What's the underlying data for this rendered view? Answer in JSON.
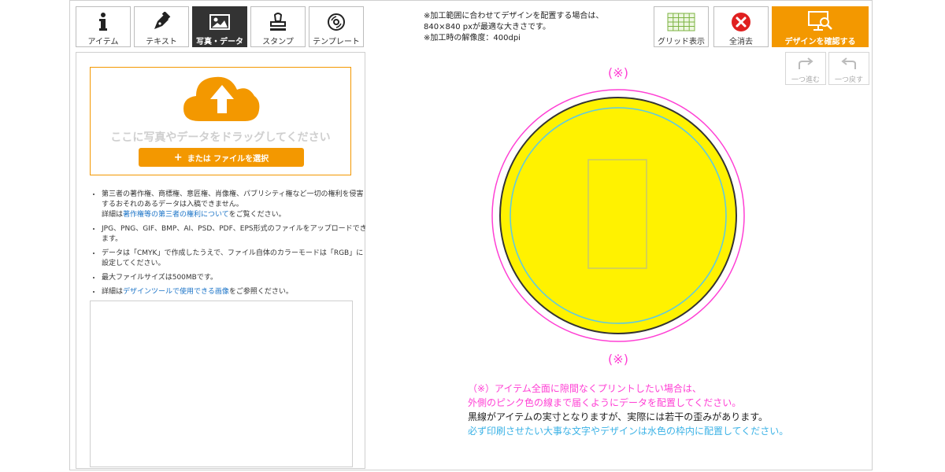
{
  "tabs": [
    {
      "label": "アイテム",
      "icon": "info-icon"
    },
    {
      "label": "テキスト",
      "icon": "pen-icon"
    },
    {
      "label": "写真・データ",
      "icon": "image-icon",
      "active": true
    },
    {
      "label": "スタンプ",
      "icon": "stamp-icon"
    },
    {
      "label": "テンプレート",
      "icon": "disc-icon"
    }
  ],
  "upload": {
    "drop_text": "ここに写真やデータをドラッグしてください",
    "file_button": "または ファイルを選択",
    "file_button_plus": "+",
    "accent": "#f39800"
  },
  "notes": {
    "n1_a": "第三者の著作権、商標権、意匠権、肖像権、パブリシティ権など一切の権利を侵害するおそれのあるデータは入稿できません。",
    "n1_b": "詳細は",
    "n1_link": "著作権等の第三者の権利について",
    "n1_c": "をご覧ください。",
    "n2": "JPG、PNG、GIF、BMP、AI、PSD、PDF、EPS形式のファイルをアップロードできます。",
    "n3": "データは「CMYK」で作成したうえで、ファイル自体のカラーモードは「RGB」に設定してください。",
    "n4": "最大ファイルサイズは500MBです。",
    "n5_a": "詳細は",
    "n5_link": "デザインツールで使用できる画像",
    "n5_b": "をご参照ください。"
  },
  "header_note": {
    "line1": "※加工範囲に合わせてデザインを配置する場合は、",
    "line2": "840×840 pxが最適な大きさです。",
    "line3": "※加工時の解像度：400dpi"
  },
  "toolbar": {
    "grid_label": "グリッド表示",
    "clear_label": "全消去",
    "confirm_label": "デザインを確認する",
    "redo_label": "一つ進む",
    "undo_label": "一つ戻す"
  },
  "canvas": {
    "marker_top": "(※)",
    "marker_bottom": "(※)",
    "item_color": "#fff200",
    "bleed_color": "#ff3fd4",
    "safe_color": "#5bc8e8"
  },
  "footnote": {
    "line1": "（※）アイテム全面に隙間なくプリントしたい場合は、",
    "line2": "外側のピンク色の線まで届くようにデータを配置してください。",
    "line3": "黒線がアイテムの実寸となりますが、実際には若干の歪みがあります。",
    "line4": "必ず印刷させたい大事な文字やデザインは水色の枠内に配置してください。"
  }
}
